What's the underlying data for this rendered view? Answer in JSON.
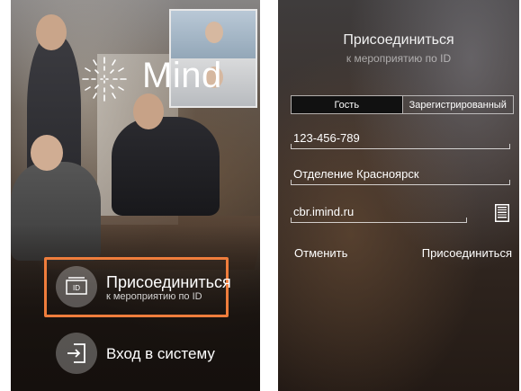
{
  "left_screen": {
    "logo_text": "Mind",
    "join_button": {
      "title": "Присоединиться",
      "subtitle": "к мероприятию по ID",
      "icon_text": "ID",
      "icon": "id-card-icon"
    },
    "login_button": {
      "label": "Вход в систему",
      "icon": "login-arrow-icon"
    },
    "highlight_color": "#ef7d3c"
  },
  "right_screen": {
    "title": "Присоединиться",
    "subtitle": "к мероприятию по ID",
    "tabs": [
      {
        "label": "Гость",
        "selected": true
      },
      {
        "label": "Зарегистрированный",
        "selected": false
      }
    ],
    "fields": {
      "conference_id": "123-456-789",
      "display_name": "Отделение Красноярск",
      "server": "cbr.imind.ru"
    },
    "qr_icon": "qr-code-icon",
    "cancel_label": "Отменить",
    "join_label": "Присоединиться"
  }
}
